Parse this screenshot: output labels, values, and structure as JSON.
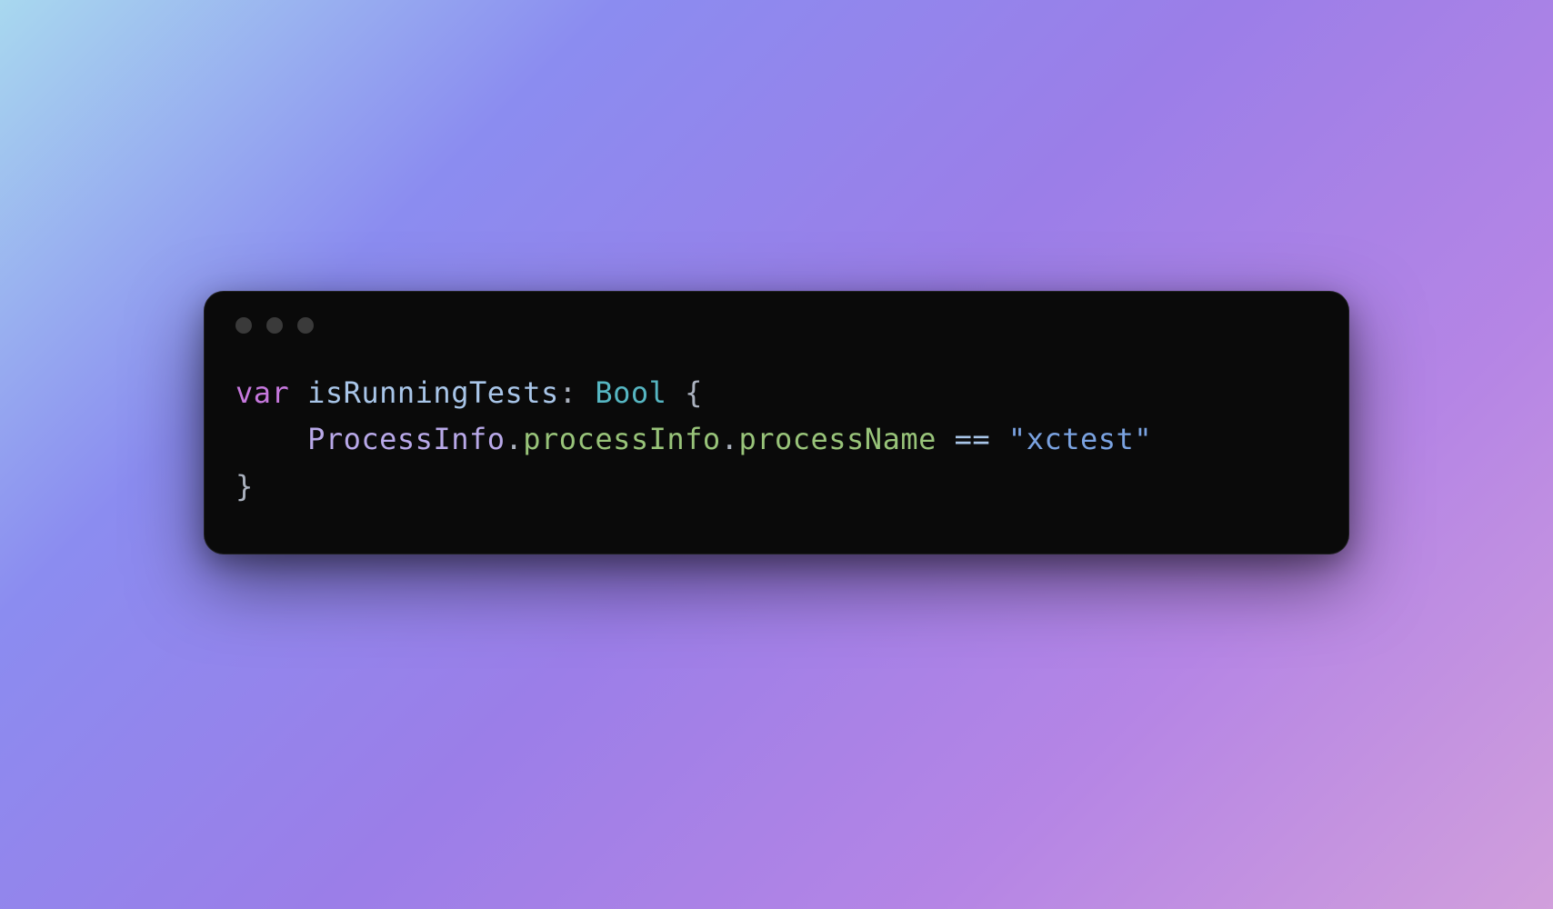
{
  "code": {
    "line1": {
      "keyword": "var",
      "space1": " ",
      "identifier": "isRunningTests",
      "colon": ": ",
      "type": "Bool",
      "space2": " ",
      "brace_open": "{"
    },
    "line2": {
      "indent": "    ",
      "type_ref": "ProcessInfo",
      "dot1": ".",
      "property1": "processInfo",
      "dot2": ".",
      "property2": "processName",
      "space1": " ",
      "operator": "==",
      "space2": " ",
      "string": "\"xctest\""
    },
    "line3": {
      "brace_close": "}"
    }
  },
  "window": {
    "traffic_lights": 3
  }
}
